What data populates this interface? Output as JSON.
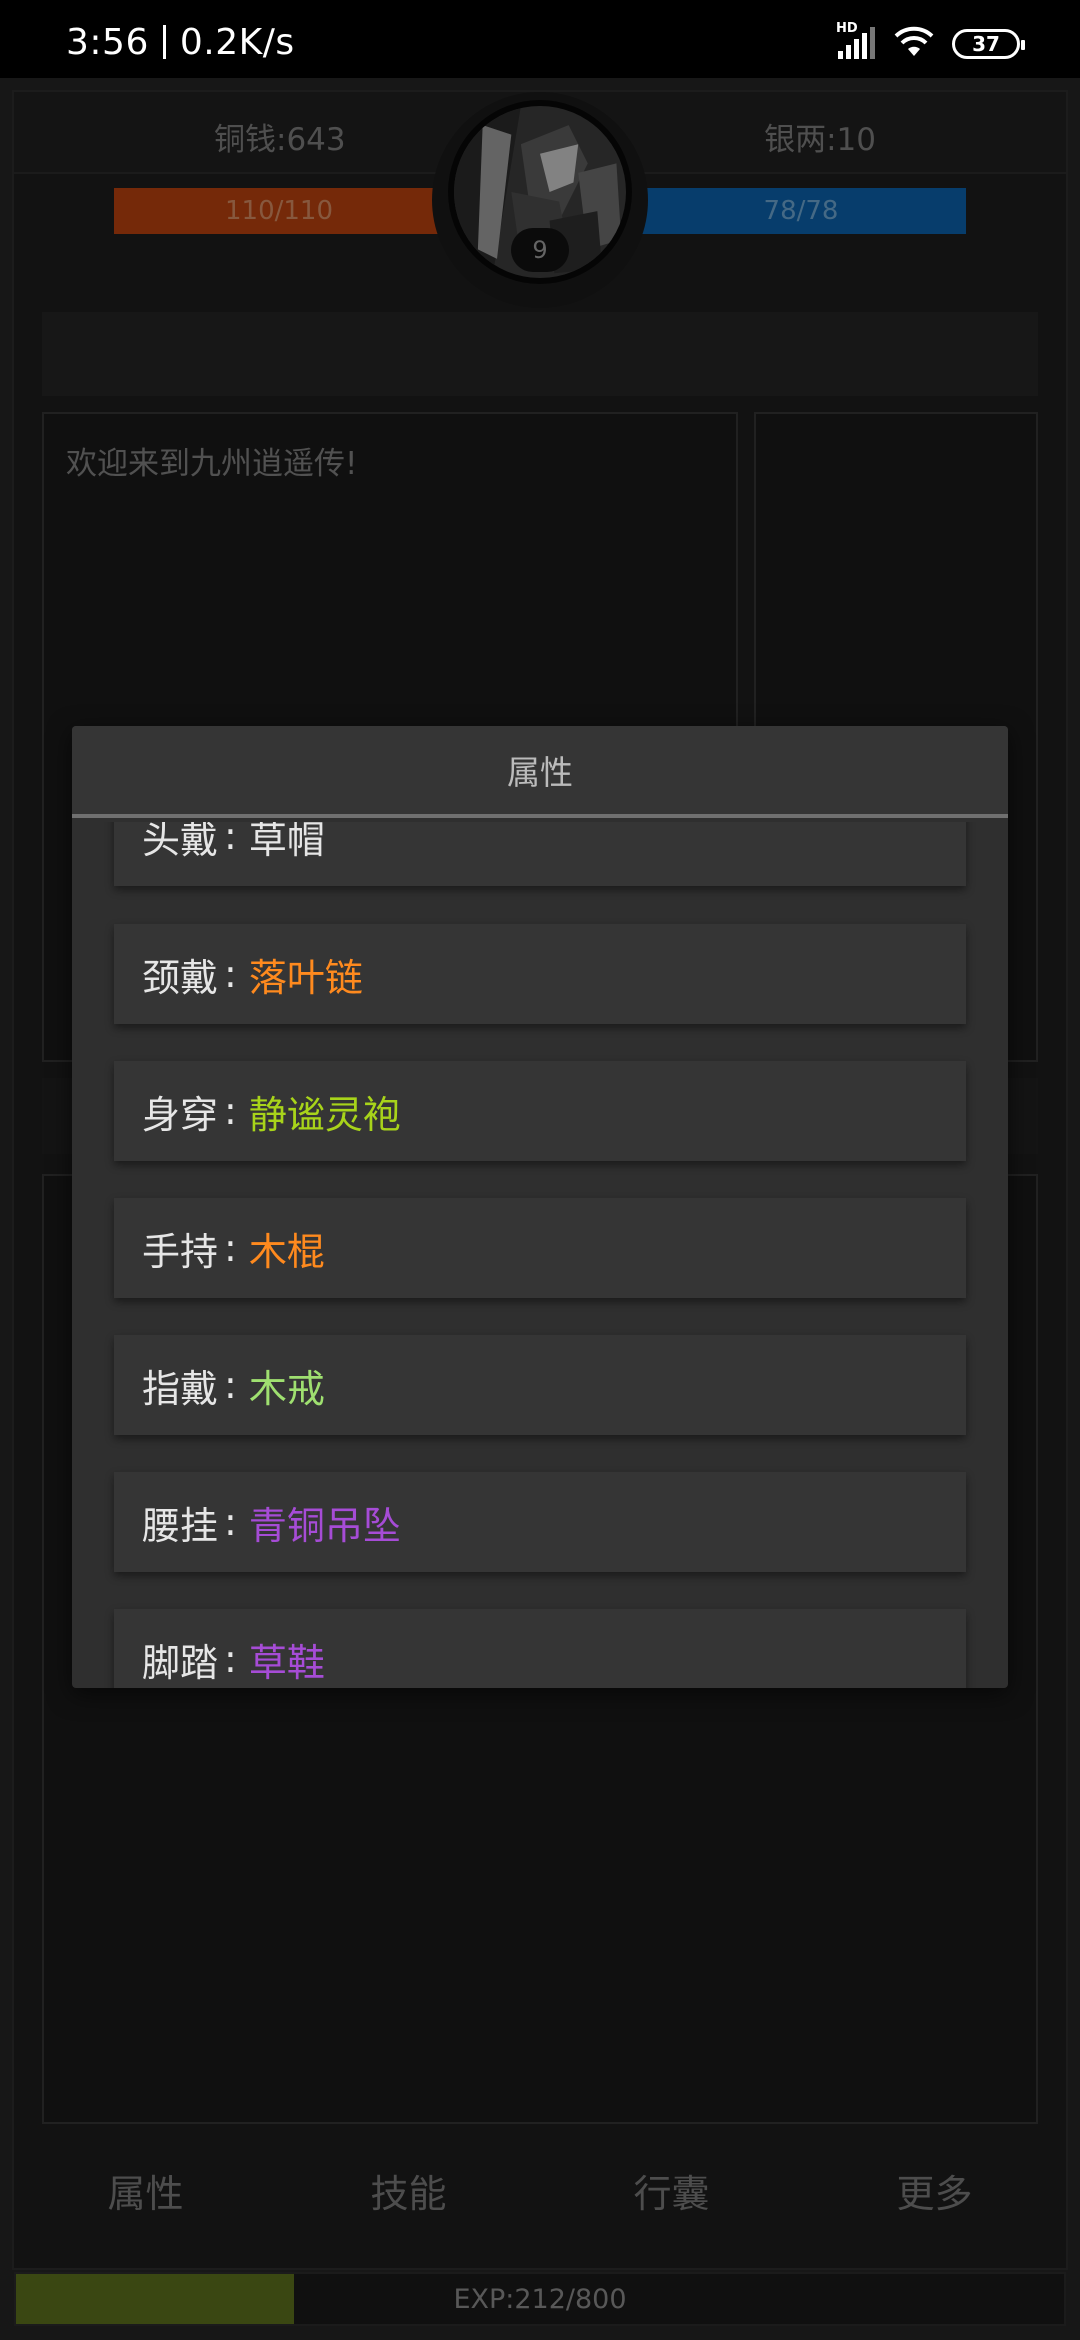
{
  "status_bar": {
    "time": "3:56",
    "net_speed": "0.2K/s",
    "signal_badge": "HD",
    "battery": "37",
    "icons": [
      "signal-icon",
      "wifi-icon",
      "battery-icon"
    ]
  },
  "header": {
    "coins": "铜钱:643",
    "silver": "银两:10",
    "hp": "110/110",
    "mp": "78/78",
    "level": "9"
  },
  "message_panel": {
    "text": "欢迎来到九州逍遥传!"
  },
  "dialog": {
    "title": "属性",
    "items": [
      {
        "label": "头戴",
        "value": "草帽",
        "color": "#e6e6e6"
      },
      {
        "label": "颈戴",
        "value": "落叶链",
        "color": "#ff8a1e"
      },
      {
        "label": "身穿",
        "value": "静谧灵袍",
        "color": "#a8d41a"
      },
      {
        "label": "手持",
        "value": "木棍",
        "color": "#ff8a1e"
      },
      {
        "label": "指戴",
        "value": "木戒",
        "color": "#9fe070"
      },
      {
        "label": "腰挂",
        "value": "青铜吊坠",
        "color": "#a64cd6"
      },
      {
        "label": "脚踏",
        "value": "草鞋",
        "color": "#a64cd6"
      }
    ]
  },
  "bottom_nav": [
    {
      "label": "属性"
    },
    {
      "label": "技能"
    },
    {
      "label": "行囊"
    },
    {
      "label": "更多"
    }
  ],
  "exp": {
    "text": "EXP:212/800",
    "fraction": 0.265,
    "color": "#596d1c"
  },
  "colors": {
    "hp": "#b4400f",
    "mp": "#0b5fa6",
    "background": "#1c1c1c"
  }
}
